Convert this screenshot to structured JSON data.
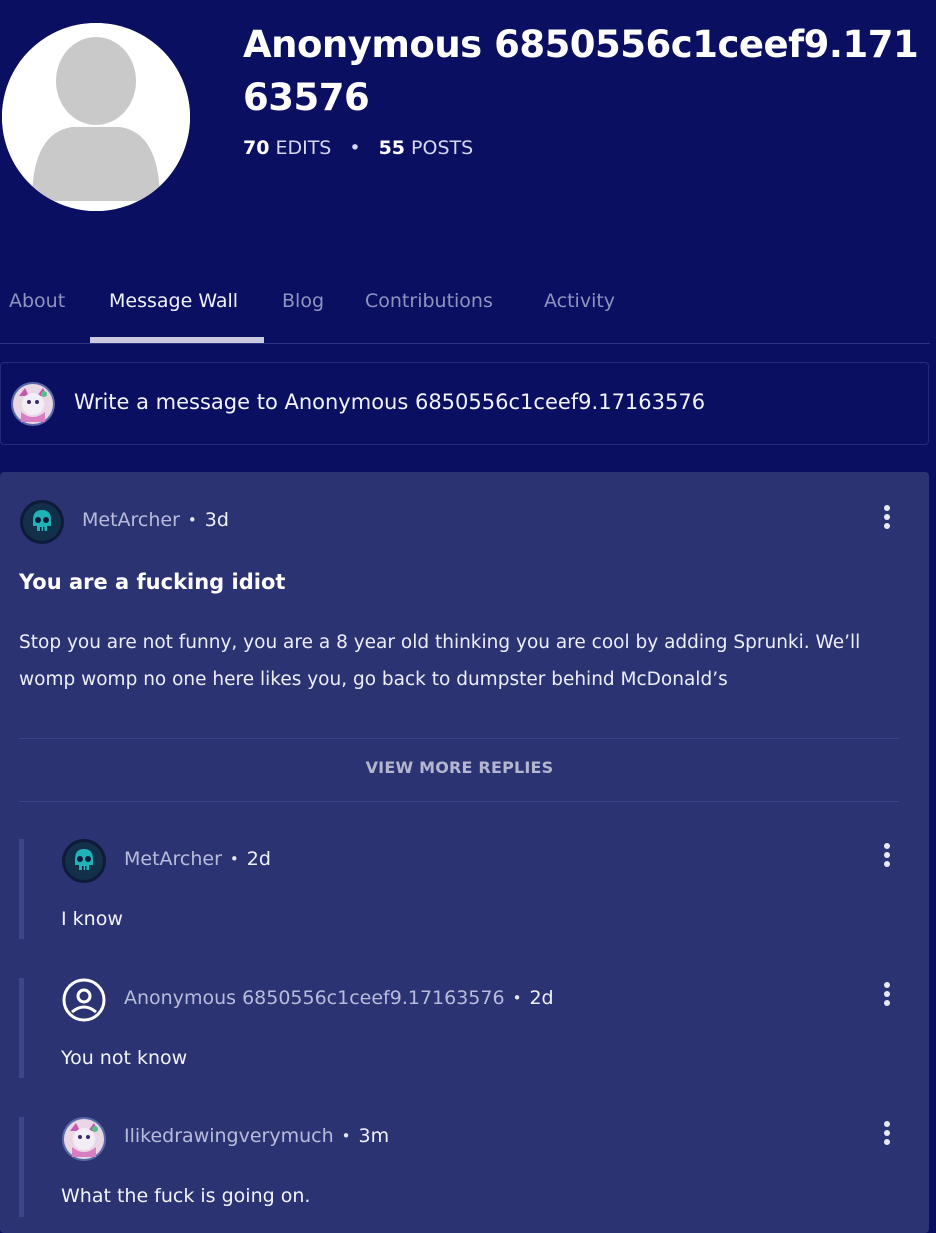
{
  "profile": {
    "username": "Anonymous 6850556c1ceef9.17163576",
    "edits_count": "70",
    "edits_label": "EDITS",
    "separator": "•",
    "posts_count": "55",
    "posts_label": "POSTS"
  },
  "tabs": [
    {
      "label": "About"
    },
    {
      "label": "Message Wall"
    },
    {
      "label": "Blog"
    },
    {
      "label": "Contributions"
    },
    {
      "label": "Activity"
    }
  ],
  "active_tab": "Message Wall",
  "composer": {
    "placeholder": "Write a message to Anonymous 6850556c1ceef9.17163576"
  },
  "thread": {
    "author": "MetArcher",
    "time": "3d",
    "dot": "•",
    "title": "You are a fucking idiot",
    "body": "Stop you are not funny, you are a 8 year old thinking you are cool by adding Sprunki. We’ll womp womp no one here likes you, go back to dumpster behind McDonald’s",
    "view_more_label": "VIEW MORE REPLIES",
    "replies": [
      {
        "author": "MetArcher",
        "time": "2d",
        "text": "I know",
        "avatar": "skull-avatar"
      },
      {
        "author": "Anonymous 6850556c1ceef9.17163576",
        "time": "2d",
        "text": "You not know",
        "avatar": "anon-user-icon"
      },
      {
        "author": "Ilikedrawingverymuch",
        "time": "3m",
        "text": "What the fuck is going on.",
        "avatar": "drawing-avatar"
      }
    ]
  },
  "colors": {
    "page_bg": "#0a0f62",
    "card_bg": "#2c3373",
    "accent_teal": "#1fb3b8"
  }
}
